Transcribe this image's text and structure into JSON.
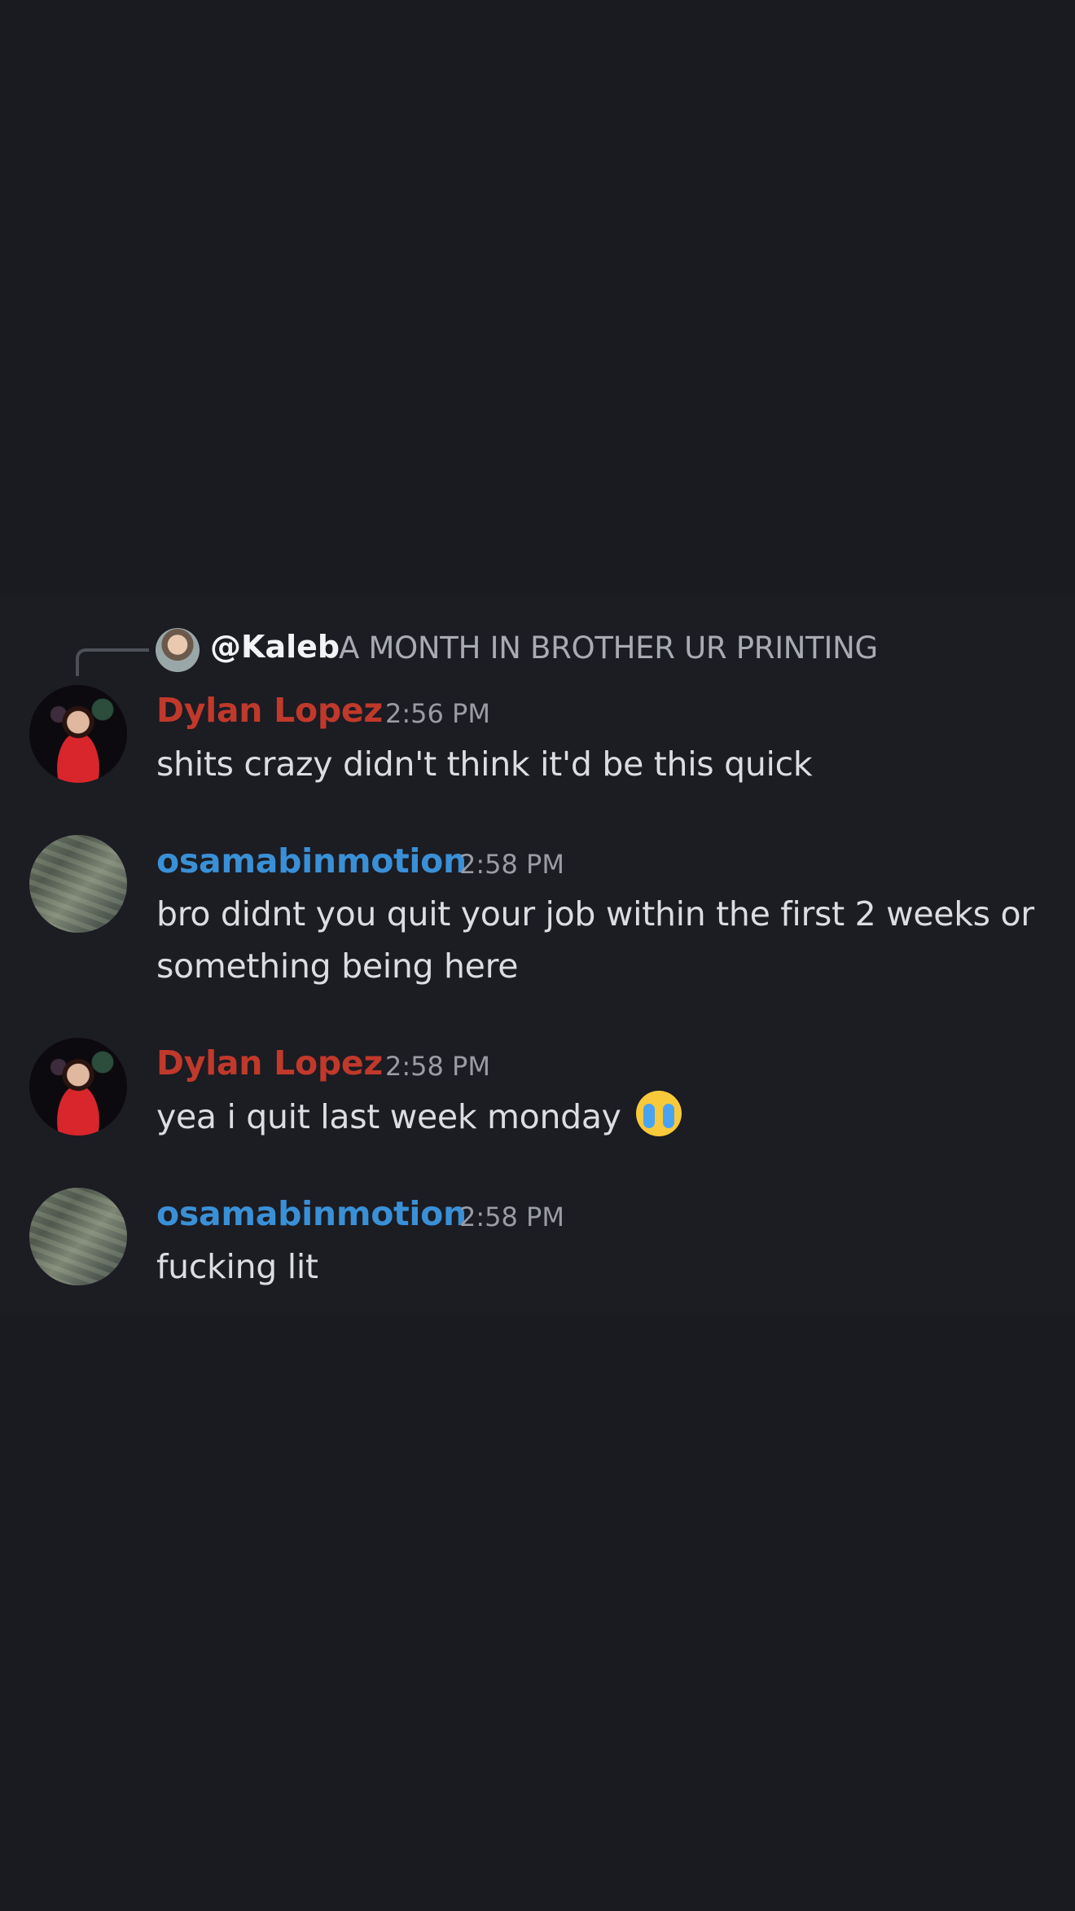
{
  "reply": {
    "username": "@Kaleb",
    "text": "A MONTH IN BROTHER UR PRINTING"
  },
  "messages": [
    {
      "username": "Dylan Lopez",
      "time": "2:56 PM",
      "lines": [
        "shits crazy didn't think it'd be this quick"
      ]
    },
    {
      "username": "osamabinmotion",
      "time": "2:58 PM",
      "lines": [
        "bro didnt you quit your job within the first 2 weeks or",
        "something being here"
      ]
    },
    {
      "username": "Dylan Lopez",
      "time": "2:58 PM",
      "lines": [
        "yea i quit last week monday"
      ],
      "emoji": "loudly-crying-face-emoji"
    },
    {
      "username": "osamabinmotion",
      "time": "2:58 PM",
      "lines": [
        "fucking lit"
      ]
    }
  ],
  "colors": {
    "background": "#1a1a21",
    "dylan_name": "#c0392b",
    "osama_name": "#3a90d6"
  }
}
